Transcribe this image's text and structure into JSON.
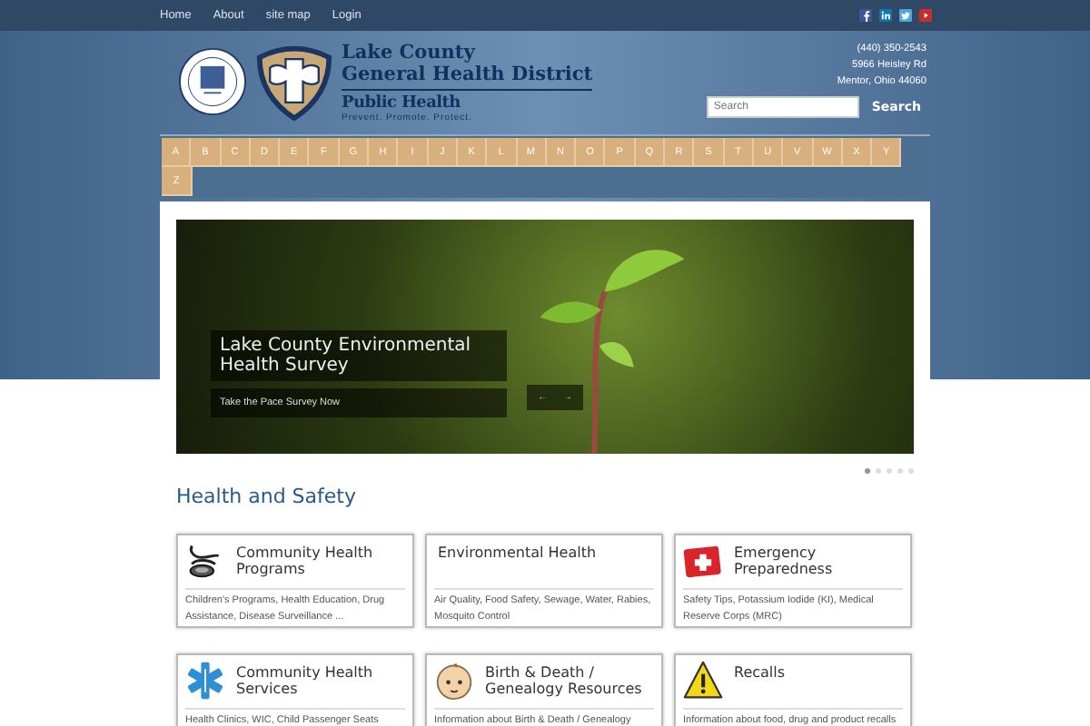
{
  "top_nav": {
    "links": [
      "Home",
      "About",
      "site map",
      "Login"
    ],
    "social": [
      {
        "kind": "facebook",
        "color": "#3b5998"
      },
      {
        "kind": "linkedin",
        "color": "#0e76a8"
      },
      {
        "kind": "twitter",
        "color": "#4fa8dc"
      },
      {
        "kind": "youtube",
        "color": "#c4302b"
      }
    ]
  },
  "header": {
    "org_line_1": "Lake County",
    "org_line_2": "General Health District",
    "brand": "Public Health",
    "tagline": "Prevent. Promote. Protect.",
    "phone": "(440) 350-2543",
    "address_1": "5966 Heisley Rd",
    "address_2": "Mentor, Ohio 44060",
    "search": {
      "placeholder": "Search",
      "button": "Search"
    }
  },
  "alphabet": [
    "A",
    "B",
    "C",
    "D",
    "E",
    "F",
    "G",
    "H",
    "I",
    "J",
    "K",
    "L",
    "M",
    "N",
    "O",
    "P",
    "Q",
    "R",
    "S",
    "T",
    "U",
    "V",
    "W",
    "X",
    "Y",
    "Z"
  ],
  "slider": {
    "title": "Lake County Environmental Health Survey",
    "link": "Take the Pace Survey Now",
    "prev": "←",
    "next": "→",
    "dots": [
      {
        "selected": true
      },
      {
        "selected": false
      },
      {
        "selected": false
      },
      {
        "selected": false
      },
      {
        "selected": false
      }
    ]
  },
  "section_title": "Health and Safety",
  "cards": [
    {
      "kind": "stethoscope",
      "title": "Community Health Programs",
      "text": "Children's Programs, Health Education, Drug Assistance, Disease Surveillance ..."
    },
    {
      "kind": "plain",
      "title": "Environmental Health",
      "text": "Air Quality, Food Safety, Sewage, Water, Rabies, Mosquito Control"
    },
    {
      "kind": "firstaid",
      "title": "Emergency Preparedness",
      "text": "Safety Tips, Potassium Iodide (KI), Medical Reserve Corps (MRC)"
    },
    {
      "kind": "star",
      "title": "Community Health Services",
      "text": "Health Clinics, WIC, Child Passenger Seats"
    },
    {
      "kind": "baby",
      "title": "Birth & Death / Genealogy Resources",
      "text": "Information about Birth & Death / Genealogy"
    },
    {
      "kind": "warning",
      "title": "Recalls",
      "text": "Information about food, drug and product recalls"
    }
  ]
}
